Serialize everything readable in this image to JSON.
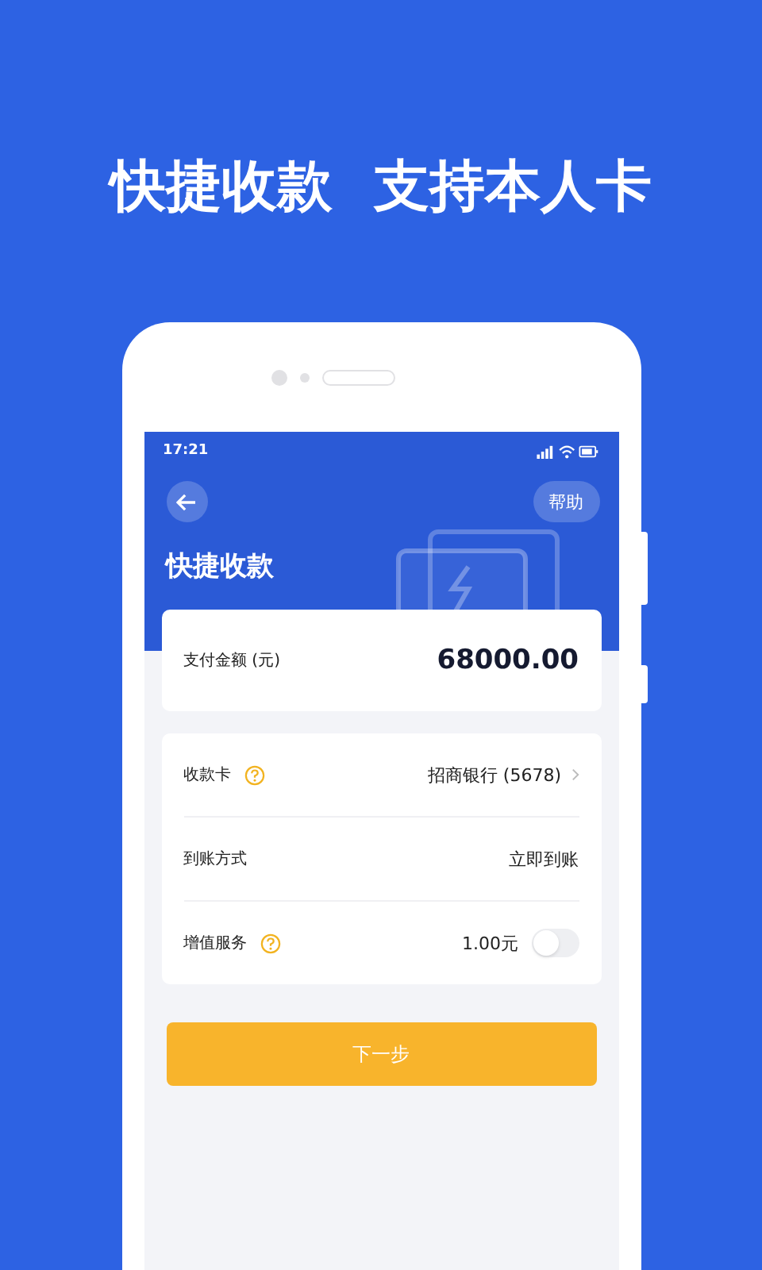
{
  "headline": [
    "快捷收款",
    "支持本人卡"
  ],
  "status_bar": {
    "time": "17:21"
  },
  "nav": {
    "title": "快捷收款",
    "help_button": "帮助"
  },
  "amount": {
    "label": "支付金额 (元)",
    "value": "68000.00"
  },
  "rows": [
    {
      "kind": "link",
      "label": "收款卡",
      "help": true,
      "value": "招商银行 (5678)"
    },
    {
      "kind": "text",
      "label": "到账方式",
      "help": false,
      "value": "立即到账"
    },
    {
      "kind": "toggle",
      "label": "增值服务",
      "help": true,
      "value": "1.00元",
      "on": false
    }
  ],
  "button": "下一步"
}
